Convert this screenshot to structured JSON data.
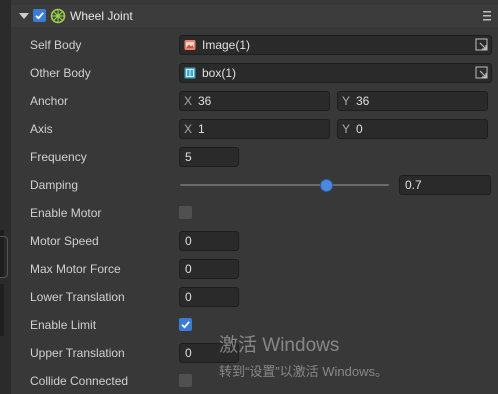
{
  "component": {
    "title": "Wheel Joint",
    "enabled": true,
    "icon": "wheel-joint-icon",
    "menu_icon": "hamburger-icon"
  },
  "properties": {
    "self_body": {
      "label": "Self Body",
      "value": "Image(1)",
      "icon": "image-icon"
    },
    "other_body": {
      "label": "Other Body",
      "value": "box(1)",
      "icon": "box-icon"
    },
    "anchor": {
      "label": "Anchor",
      "x_axis": "X",
      "x": "36",
      "y_axis": "Y",
      "y": "36"
    },
    "axis": {
      "label": "Axis",
      "x_axis": "X",
      "x": "1",
      "y_axis": "Y",
      "y": "0"
    },
    "frequency": {
      "label": "Frequency",
      "value": "5"
    },
    "damping": {
      "label": "Damping",
      "value": "0.7",
      "slider_fraction": 0.7
    },
    "enable_motor": {
      "label": "Enable Motor",
      "checked": false
    },
    "motor_speed": {
      "label": "Motor Speed",
      "value": "0"
    },
    "max_motor_force": {
      "label": "Max Motor Force",
      "value": "0"
    },
    "lower_translation": {
      "label": "Lower Translation",
      "value": "0"
    },
    "enable_limit": {
      "label": "Enable Limit",
      "checked": true
    },
    "upper_translation": {
      "label": "Upper Translation",
      "value": "0"
    },
    "collide_connected": {
      "label": "Collide Connected",
      "checked": false
    }
  },
  "watermark": {
    "title": "激活 Windows",
    "subtitle": "转到“设置”以激活 Windows。"
  },
  "colors": {
    "panel_bg": "#383838",
    "field_bg": "#2a2a2a",
    "accent": "#3a7bd5"
  }
}
